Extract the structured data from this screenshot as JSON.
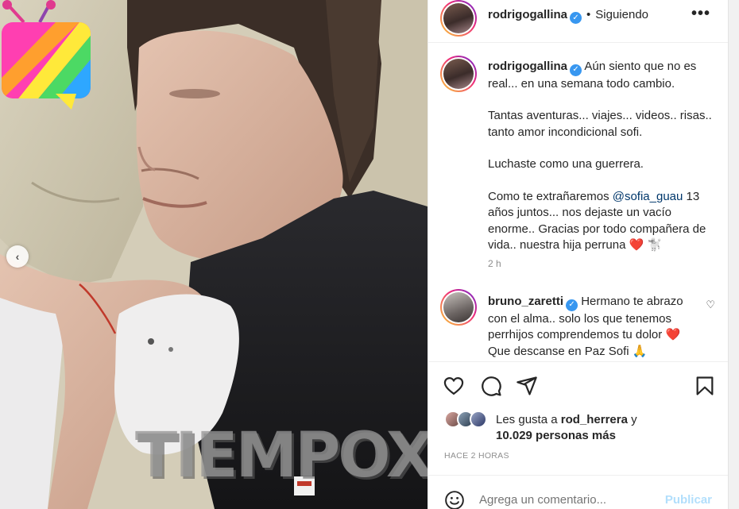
{
  "post": {
    "username": "rodrigogallina",
    "verified_mark": "✓",
    "separator": "•",
    "follow_status": "Siguiendo",
    "more_glyph": "•••",
    "caption_paragraphs": [
      "Aún siento que no es real... en una semana todo cambio.",
      "Tantas aventuras... viajes... videos.. risas.. tanto amor incondicional sofi.",
      "Luchaste como una guerrera."
    ],
    "caption_last_pre": "Como te extrañaremos ",
    "caption_mention": "@sofia_guau",
    "caption_last_post": " 13 años juntos... nos dejaste un vacío enorme.. Gracias por todo compañera de vida.. nuestra hija perruna ❤️  🐩",
    "caption_time": "2 h"
  },
  "comment": {
    "username": "bruno_zaretti",
    "text": "Hermano te abrazo con el alma.. solo los que tenemos perrhijos comprendemos tu dolor ❤️ Que descanse en Paz Sofi 🙏",
    "heart_glyph": "♡"
  },
  "likes": {
    "line1_pre": "Les gusta a ",
    "line1_user": "rod_herrera",
    "line1_post": " y",
    "line2": "10.029 personas más"
  },
  "timestamp": "HACE 2 HORAS",
  "add_comment": {
    "placeholder": "Agrega un comentario...",
    "publish_label": "Publicar"
  },
  "watermark": {
    "text": "TIEMPOX"
  },
  "nav": {
    "prev_glyph": "‹"
  },
  "colors": {
    "verified": "#3897f0",
    "mention": "#00376b",
    "publish_disabled": "#b2dffc",
    "heart": "#ed4956"
  },
  "icons": [
    "heart-icon",
    "comment-icon",
    "share-icon",
    "bookmark-icon",
    "emoji-icon",
    "more-icon",
    "verified-icon",
    "chevron-left-icon"
  ]
}
